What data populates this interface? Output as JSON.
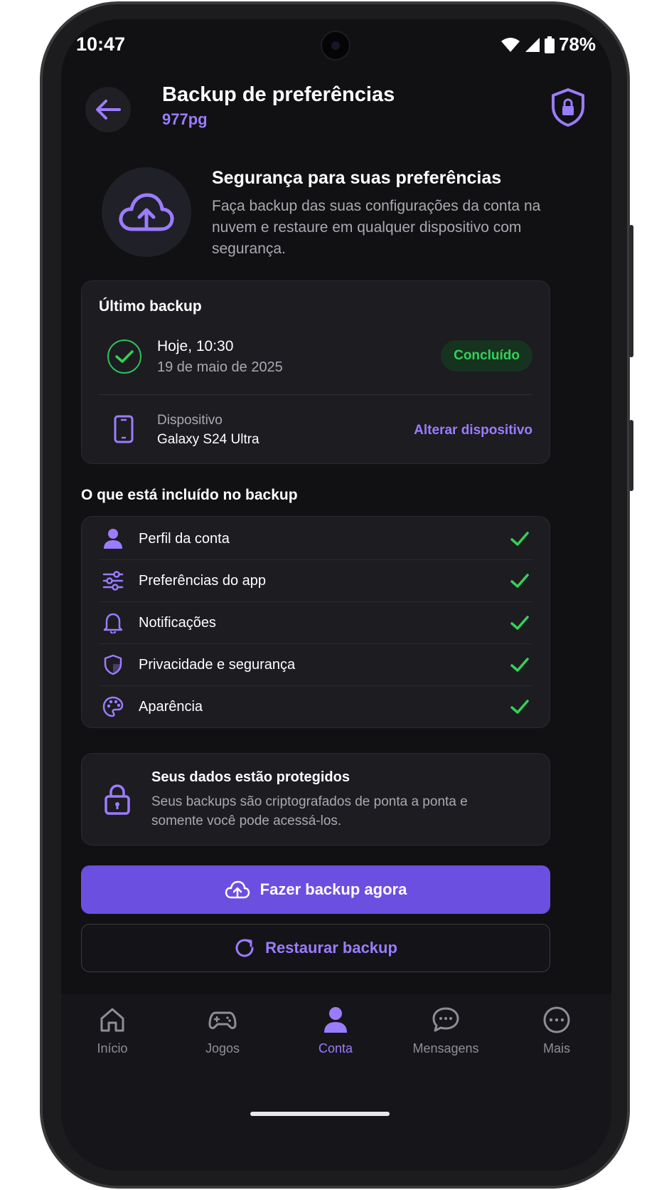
{
  "status_bar": {
    "time": "10:47",
    "battery": "78%"
  },
  "header": {
    "title": "Backup de preferências",
    "subtitle": "977pg"
  },
  "intro": {
    "title": "Segurança para suas preferências",
    "text": "Faça backup das suas configurações da conta na nuvem e restaure em qualquer dispositivo com segurança."
  },
  "last_backup": {
    "label": "Último backup",
    "time": "Hoje, 10:30",
    "date": "19 de maio de 2025",
    "status": "Concluído",
    "device_label": "Dispositivo",
    "device_name": "Galaxy S24 Ultra",
    "change_device": "Alterar dispositivo"
  },
  "included": {
    "title": "O que está incluído no backup",
    "items": [
      {
        "label": "Perfil da conta",
        "icon": "person-icon"
      },
      {
        "label": "Preferências do app",
        "icon": "sliders-icon"
      },
      {
        "label": "Notificações",
        "icon": "bell-icon"
      },
      {
        "label": "Privacidade e segurança",
        "icon": "shield-icon"
      },
      {
        "label": "Aparência",
        "icon": "palette-icon"
      }
    ]
  },
  "protection": {
    "title": "Seus dados estão protegidos",
    "text": "Seus backups são criptografados de ponta a ponta e somente você pode acessá-los."
  },
  "actions": {
    "primary": "Fazer backup agora",
    "secondary": "Restaurar backup"
  },
  "nav": {
    "items": [
      {
        "label": "Início",
        "icon": "home-icon"
      },
      {
        "label": "Jogos",
        "icon": "gamepad-icon"
      },
      {
        "label": "Conta",
        "icon": "person-icon",
        "active": true
      },
      {
        "label": "Mensagens",
        "icon": "chat-icon"
      },
      {
        "label": "Mais",
        "icon": "more-icon"
      }
    ]
  },
  "colors": {
    "accent": "#6b4fe0",
    "accent_text": "#9b7cff",
    "success": "#34d158",
    "background": "#111114"
  }
}
